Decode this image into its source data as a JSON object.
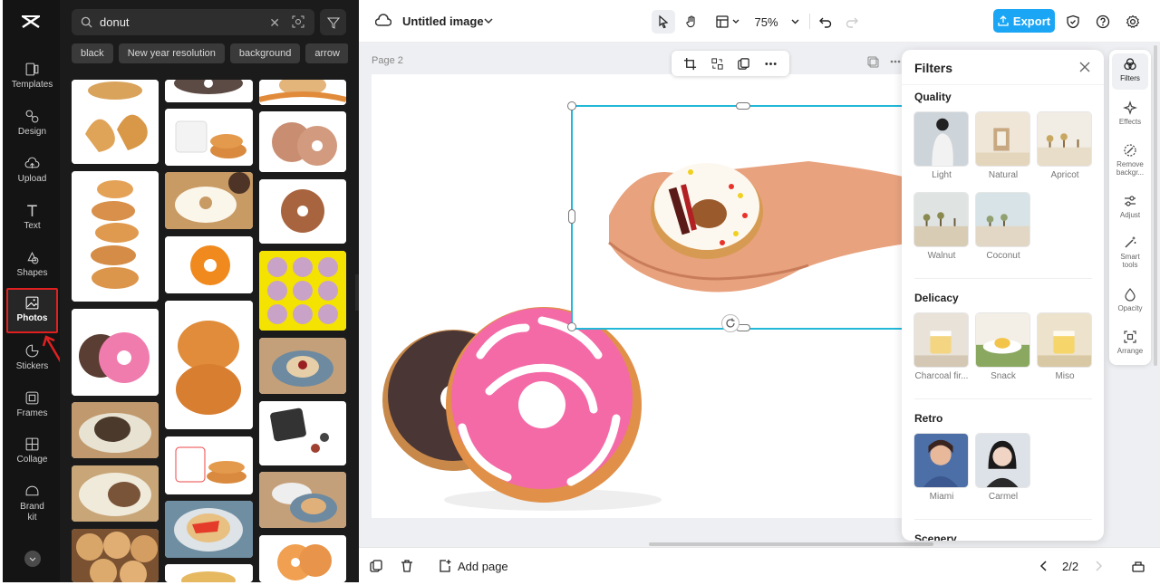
{
  "rail": {
    "items": [
      {
        "label": "Templates"
      },
      {
        "label": "Design"
      },
      {
        "label": "Upload"
      },
      {
        "label": "Text"
      },
      {
        "label": "Shapes"
      },
      {
        "label": "Photos"
      },
      {
        "label": "Stickers"
      },
      {
        "label": "Frames"
      },
      {
        "label": "Collage"
      },
      {
        "label": "Brand kit"
      }
    ]
  },
  "search": {
    "value": "donut"
  },
  "chips": [
    "black",
    "New year resolution",
    "background",
    "arrow"
  ],
  "topbar": {
    "title": "Untitled image",
    "zoom": "75%",
    "export": "Export"
  },
  "canvas": {
    "page_label": "Page 2"
  },
  "bottombar": {
    "add_page": "Add page",
    "page_count": "2/2"
  },
  "filters": {
    "title": "Filters",
    "sections": [
      {
        "title": "Quality",
        "items": [
          "Light",
          "Natural",
          "Apricot",
          "Walnut",
          "Coconut"
        ]
      },
      {
        "title": "Delicacy",
        "items": [
          "Charcoal fir...",
          "Snack",
          "Miso"
        ]
      },
      {
        "title": "Retro",
        "items": [
          "Miami",
          "Carmel"
        ]
      },
      {
        "title": "Scenery",
        "items": []
      }
    ]
  },
  "tools": [
    "Filters",
    "Effects",
    "Remove backgr...",
    "Adjust",
    "Smart tools",
    "Opacity",
    "Arrange"
  ],
  "colors": {
    "accent": "#1ba6f5",
    "selection": "#22b8d8",
    "highlight": "#e02020"
  }
}
